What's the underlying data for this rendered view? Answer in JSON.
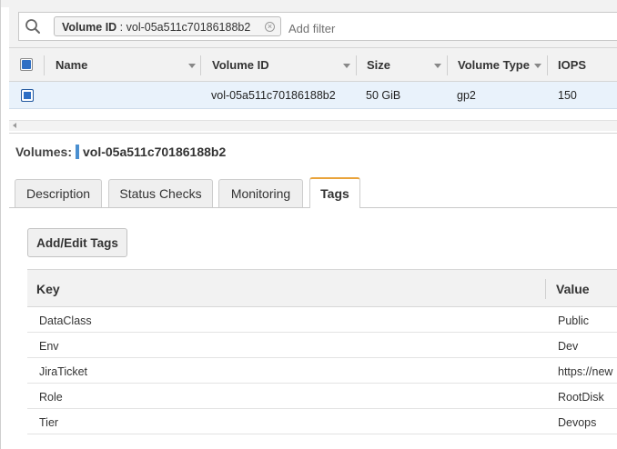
{
  "filter": {
    "token_key": "Volume ID",
    "token_sep": " : ",
    "token_value": "vol-05a511c70186188b2",
    "placeholder": "Add filter"
  },
  "volumes_table": {
    "columns": [
      "Name",
      "Volume ID",
      "Size",
      "Volume Type",
      "IOPS"
    ],
    "rows": [
      {
        "name": "",
        "volume_id": "vol-05a511c70186188b2",
        "size": "50 GiB",
        "volume_type": "gp2",
        "iops": "150"
      }
    ]
  },
  "detail": {
    "label": "Volumes:",
    "volume_id": "vol-05a511c70186188b2"
  },
  "tabs": [
    {
      "label": "Description",
      "active": false
    },
    {
      "label": "Status Checks",
      "active": false
    },
    {
      "label": "Monitoring",
      "active": false
    },
    {
      "label": "Tags",
      "active": true
    }
  ],
  "tags_panel": {
    "edit_button": "Add/Edit Tags",
    "columns": [
      "Key",
      "Value"
    ],
    "rows": [
      {
        "key": "DataClass",
        "value": "Public"
      },
      {
        "key": "Env",
        "value": "Dev"
      },
      {
        "key": "JiraTicket",
        "value": "https://new"
      },
      {
        "key": "Role",
        "value": "RootDisk"
      },
      {
        "key": "Tier",
        "value": "Devops"
      }
    ]
  },
  "colors": {
    "selected_row": "#e9f2fb",
    "checkbox": "#2f6fc4",
    "active_tab_accent": "#e9a33a",
    "detail_marker": "#4a8fd0"
  },
  "icons": {
    "search": "search-icon",
    "remove_token": "close-circle-icon",
    "sort": "caret-down-icon",
    "scroll": "arrow-left-icon"
  }
}
